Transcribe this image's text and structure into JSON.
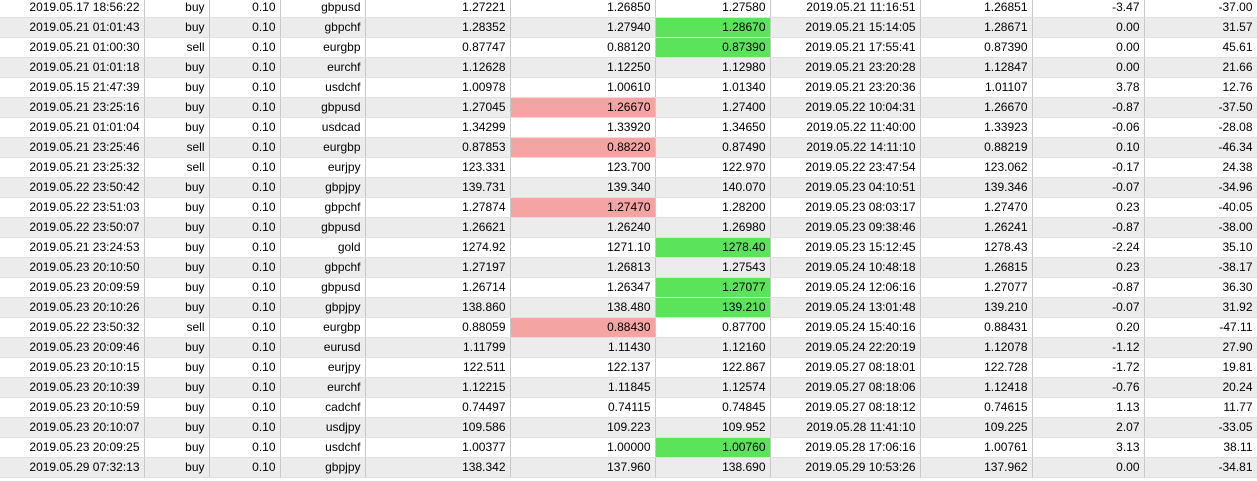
{
  "colors": {
    "take_profit_hit": "#5be35b",
    "stop_loss_hit": "#f5a4a4",
    "alt_row": "#ececec"
  },
  "trades": [
    {
      "open_time": "2019.05.17 18:56:22",
      "type": "buy",
      "size": "0.10",
      "symbol": "gbpusd",
      "open_price": "1.27221",
      "sl": "1.26850",
      "tp": "1.27580",
      "close_time": "2019.05.21 11:16:51",
      "close_price": "1.26851",
      "swap": "-3.47",
      "profit": "-37.00",
      "hl": ""
    },
    {
      "open_time": "2019.05.21 01:01:43",
      "type": "buy",
      "size": "0.10",
      "symbol": "gbpchf",
      "open_price": "1.28352",
      "sl": "1.27940",
      "tp": "1.28670",
      "close_time": "2019.05.21 15:14:05",
      "close_price": "1.28671",
      "swap": "0.00",
      "profit": "31.57",
      "hl": "tp"
    },
    {
      "open_time": "2019.05.21 01:00:30",
      "type": "sell",
      "size": "0.10",
      "symbol": "eurgbp",
      "open_price": "0.87747",
      "sl": "0.88120",
      "tp": "0.87390",
      "close_time": "2019.05.21 17:55:41",
      "close_price": "0.87390",
      "swap": "0.00",
      "profit": "45.61",
      "hl": "tp"
    },
    {
      "open_time": "2019.05.21 01:01:18",
      "type": "buy",
      "size": "0.10",
      "symbol": "eurchf",
      "open_price": "1.12628",
      "sl": "1.12250",
      "tp": "1.12980",
      "close_time": "2019.05.21 23:20:28",
      "close_price": "1.12847",
      "swap": "0.00",
      "profit": "21.66",
      "hl": ""
    },
    {
      "open_time": "2019.05.15 21:47:39",
      "type": "buy",
      "size": "0.10",
      "symbol": "usdchf",
      "open_price": "1.00978",
      "sl": "1.00610",
      "tp": "1.01340",
      "close_time": "2019.05.21 23:20:36",
      "close_price": "1.01107",
      "swap": "3.78",
      "profit": "12.76",
      "hl": ""
    },
    {
      "open_time": "2019.05.21 23:25:16",
      "type": "buy",
      "size": "0.10",
      "symbol": "gbpusd",
      "open_price": "1.27045",
      "sl": "1.26670",
      "tp": "1.27400",
      "close_time": "2019.05.22 10:04:31",
      "close_price": "1.26670",
      "swap": "-0.87",
      "profit": "-37.50",
      "hl": "sl"
    },
    {
      "open_time": "2019.05.21 01:01:04",
      "type": "buy",
      "size": "0.10",
      "symbol": "usdcad",
      "open_price": "1.34299",
      "sl": "1.33920",
      "tp": "1.34650",
      "close_time": "2019.05.22 11:40:00",
      "close_price": "1.33923",
      "swap": "-0.06",
      "profit": "-28.08",
      "hl": ""
    },
    {
      "open_time": "2019.05.21 23:25:46",
      "type": "sell",
      "size": "0.10",
      "symbol": "eurgbp",
      "open_price": "0.87853",
      "sl": "0.88220",
      "tp": "0.87490",
      "close_time": "2019.05.22 14:11:10",
      "close_price": "0.88219",
      "swap": "0.10",
      "profit": "-46.34",
      "hl": "sl"
    },
    {
      "open_time": "2019.05.21 23:25:32",
      "type": "sell",
      "size": "0.10",
      "symbol": "eurjpy",
      "open_price": "123.331",
      "sl": "123.700",
      "tp": "122.970",
      "close_time": "2019.05.22 23:47:54",
      "close_price": "123.062",
      "swap": "-0.17",
      "profit": "24.38",
      "hl": ""
    },
    {
      "open_time": "2019.05.22 23:50:42",
      "type": "buy",
      "size": "0.10",
      "symbol": "gbpjpy",
      "open_price": "139.731",
      "sl": "139.340",
      "tp": "140.070",
      "close_time": "2019.05.23 04:10:51",
      "close_price": "139.346",
      "swap": "-0.07",
      "profit": "-34.96",
      "hl": ""
    },
    {
      "open_time": "2019.05.22 23:51:03",
      "type": "buy",
      "size": "0.10",
      "symbol": "gbpchf",
      "open_price": "1.27874",
      "sl": "1.27470",
      "tp": "1.28200",
      "close_time": "2019.05.23 08:03:17",
      "close_price": "1.27470",
      "swap": "0.23",
      "profit": "-40.05",
      "hl": "sl"
    },
    {
      "open_time": "2019.05.22 23:50:07",
      "type": "buy",
      "size": "0.10",
      "symbol": "gbpusd",
      "open_price": "1.26621",
      "sl": "1.26240",
      "tp": "1.26980",
      "close_time": "2019.05.23 09:38:46",
      "close_price": "1.26241",
      "swap": "-0.87",
      "profit": "-38.00",
      "hl": ""
    },
    {
      "open_time": "2019.05.21 23:24:53",
      "type": "buy",
      "size": "0.10",
      "symbol": "gold",
      "open_price": "1274.92",
      "sl": "1271.10",
      "tp": "1278.40",
      "close_time": "2019.05.23 15:12:45",
      "close_price": "1278.43",
      "swap": "-2.24",
      "profit": "35.10",
      "hl": "tp"
    },
    {
      "open_time": "2019.05.23 20:10:50",
      "type": "buy",
      "size": "0.10",
      "symbol": "gbpchf",
      "open_price": "1.27197",
      "sl": "1.26813",
      "tp": "1.27543",
      "close_time": "2019.05.24 10:48:18",
      "close_price": "1.26815",
      "swap": "0.23",
      "profit": "-38.17",
      "hl": ""
    },
    {
      "open_time": "2019.05.23 20:09:59",
      "type": "buy",
      "size": "0.10",
      "symbol": "gbpusd",
      "open_price": "1.26714",
      "sl": "1.26347",
      "tp": "1.27077",
      "close_time": "2019.05.24 12:06:16",
      "close_price": "1.27077",
      "swap": "-0.87",
      "profit": "36.30",
      "hl": "tp"
    },
    {
      "open_time": "2019.05.23 20:10:26",
      "type": "buy",
      "size": "0.10",
      "symbol": "gbpjpy",
      "open_price": "138.860",
      "sl": "138.480",
      "tp": "139.210",
      "close_time": "2019.05.24 13:01:48",
      "close_price": "139.210",
      "swap": "-0.07",
      "profit": "31.92",
      "hl": "tp"
    },
    {
      "open_time": "2019.05.22 23:50:32",
      "type": "sell",
      "size": "0.10",
      "symbol": "eurgbp",
      "open_price": "0.88059",
      "sl": "0.88430",
      "tp": "0.87700",
      "close_time": "2019.05.24 15:40:16",
      "close_price": "0.88431",
      "swap": "0.20",
      "profit": "-47.11",
      "hl": "sl"
    },
    {
      "open_time": "2019.05.23 20:09:46",
      "type": "buy",
      "size": "0.10",
      "symbol": "eurusd",
      "open_price": "1.11799",
      "sl": "1.11430",
      "tp": "1.12160",
      "close_time": "2019.05.24 22:20:19",
      "close_price": "1.12078",
      "swap": "-1.12",
      "profit": "27.90",
      "hl": ""
    },
    {
      "open_time": "2019.05.23 20:10:15",
      "type": "buy",
      "size": "0.10",
      "symbol": "eurjpy",
      "open_price": "122.511",
      "sl": "122.137",
      "tp": "122.867",
      "close_time": "2019.05.27 08:18:01",
      "close_price": "122.728",
      "swap": "-1.72",
      "profit": "19.81",
      "hl": ""
    },
    {
      "open_time": "2019.05.23 20:10:39",
      "type": "buy",
      "size": "0.10",
      "symbol": "eurchf",
      "open_price": "1.12215",
      "sl": "1.11845",
      "tp": "1.12574",
      "close_time": "2019.05.27 08:18:06",
      "close_price": "1.12418",
      "swap": "-0.76",
      "profit": "20.24",
      "hl": ""
    },
    {
      "open_time": "2019.05.23 20:10:59",
      "type": "buy",
      "size": "0.10",
      "symbol": "cadchf",
      "open_price": "0.74497",
      "sl": "0.74115",
      "tp": "0.74845",
      "close_time": "2019.05.27 08:18:12",
      "close_price": "0.74615",
      "swap": "1.13",
      "profit": "11.77",
      "hl": ""
    },
    {
      "open_time": "2019.05.23 20:10:07",
      "type": "buy",
      "size": "0.10",
      "symbol": "usdjpy",
      "open_price": "109.586",
      "sl": "109.223",
      "tp": "109.952",
      "close_time": "2019.05.28 11:41:10",
      "close_price": "109.225",
      "swap": "2.07",
      "profit": "-33.05",
      "hl": ""
    },
    {
      "open_time": "2019.05.23 20:09:25",
      "type": "buy",
      "size": "0.10",
      "symbol": "usdchf",
      "open_price": "1.00377",
      "sl": "1.00000",
      "tp": "1.00760",
      "close_time": "2019.05.28 17:06:16",
      "close_price": "1.00761",
      "swap": "3.13",
      "profit": "38.11",
      "hl": "tp"
    },
    {
      "open_time": "2019.05.29 07:32:13",
      "type": "buy",
      "size": "0.10",
      "symbol": "gbpjpy",
      "open_price": "138.342",
      "sl": "137.960",
      "tp": "138.690",
      "close_time": "2019.05.29 10:53:26",
      "close_price": "137.962",
      "swap": "0.00",
      "profit": "-34.81",
      "hl": ""
    }
  ]
}
